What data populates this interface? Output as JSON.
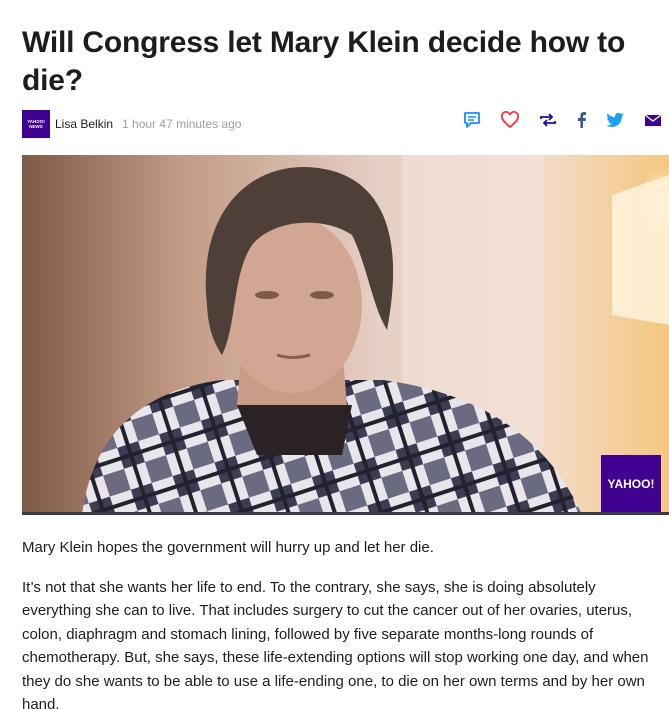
{
  "article": {
    "headline": "Will Congress let Mary Klein decide how to die?",
    "author": "Lisa Belkin",
    "timestamp": "1 hour 47 minutes ago",
    "brand": {
      "logo_line1": "YAHOO!",
      "logo_line2": "NEWS",
      "color": "#400090"
    },
    "video": {
      "badge": "YAHOO!"
    },
    "caption": "Mary Klein hopes the government will hurry up and let her die.",
    "paragraph": "It’s not that she wants her life to end. To the contrary, she says, she is doing absolutely everything she can to live. That includes surgery to cut the cancer out of her ovaries, uterus, colon, diaphragm and stomach lining, followed by five separate months-long rounds of chemotherapy. But, she says, these life-extending options will stop working one day, and when they do she wants to be able to use a life-ending one, to die on her own terms and by her own hand."
  },
  "share_bar": {
    "icons": [
      "comment-icon",
      "heart-icon",
      "retweet-icon",
      "facebook-icon",
      "twitter-icon",
      "mail-icon"
    ],
    "colors": {
      "comment": "#188fff",
      "heart": "#ff333a",
      "retweet": "#1a0dab",
      "facebook": "#3b5998",
      "twitter": "#1da1f2",
      "mail": "#400090"
    }
  }
}
